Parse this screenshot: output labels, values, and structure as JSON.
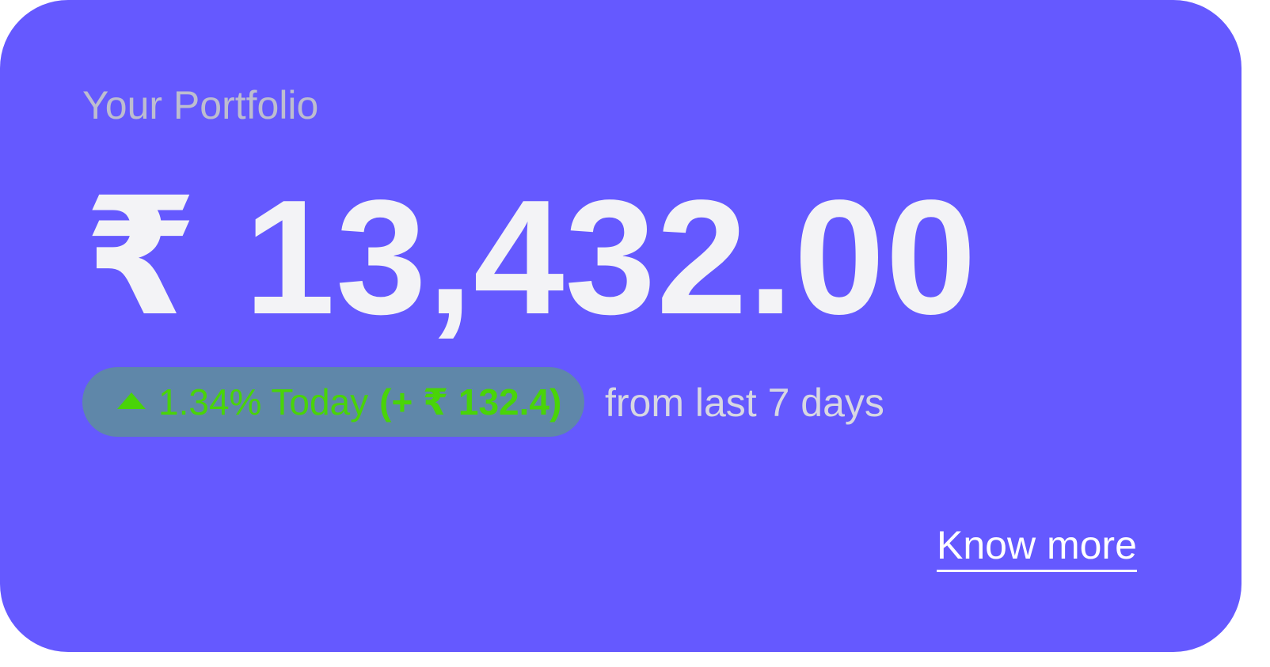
{
  "portfolio": {
    "title": "Your Portfolio",
    "balance": "₹ 13,432.00",
    "change": {
      "icon": "arrow-up-icon",
      "percent": "1.34% Today",
      "amount": "(+ ₹ 132.4)",
      "color": "#49d408"
    },
    "period": "from last 7 days",
    "cta_label": "Know more"
  },
  "colors": {
    "card_background": "#6559ff",
    "pill_background": "#5f87a9"
  }
}
